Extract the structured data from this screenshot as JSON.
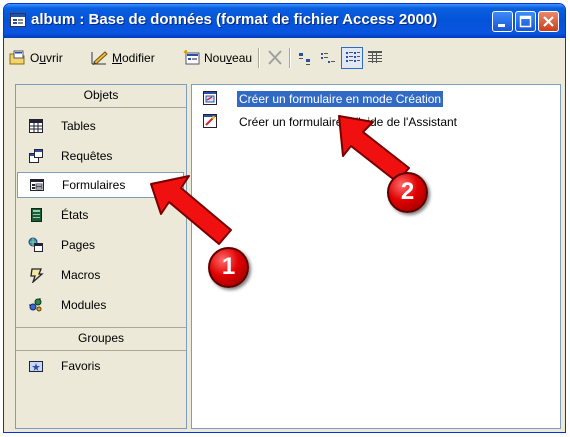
{
  "window": {
    "title": "album : Base de données (format de fichier Access 2000)"
  },
  "toolbar": {
    "open": {
      "pre": "O",
      "ul": "u",
      "post": "vrir",
      "icon": "open-form-icon"
    },
    "modify": {
      "ul": "M",
      "post": "odifier",
      "icon": "design-view-icon"
    },
    "new": {
      "pre": "Nou",
      "ul": "v",
      "post": "eau",
      "icon": "new-object-icon"
    },
    "delete_icon": "delete-x-icon",
    "views": [
      "large-icons-view-icon",
      "small-icons-view-icon",
      "list-view-icon",
      "details-view-icon"
    ],
    "active_view": "list-view-icon"
  },
  "objects_pane": {
    "header": "Objets",
    "items": [
      {
        "label": "Tables",
        "icon": "table-icon"
      },
      {
        "label": "Requêtes",
        "icon": "query-icon"
      },
      {
        "label": "Formulaires",
        "icon": "form-icon",
        "selected": true
      },
      {
        "label": "États",
        "icon": "report-icon"
      },
      {
        "label": "Pages",
        "icon": "page-icon"
      },
      {
        "label": "Macros",
        "icon": "macro-icon"
      },
      {
        "label": "Modules",
        "icon": "module-icon"
      }
    ],
    "groups_header": "Groupes",
    "groups": [
      {
        "label": "Favoris",
        "icon": "favorites-icon"
      }
    ]
  },
  "list": {
    "items": [
      {
        "label": "Créer un formulaire en mode Création",
        "icon": "design-form-icon",
        "selected": true
      },
      {
        "label": "Créer un formulaire à l'aide de l'Assistant",
        "icon": "wizard-form-icon",
        "selected": false
      }
    ]
  },
  "callouts": [
    {
      "number": "1",
      "color": "#e00000"
    },
    {
      "number": "2",
      "color": "#e00000"
    }
  ],
  "colors": {
    "titlebar": "#0453d8",
    "selection": "#316ac5",
    "window_bg": "#ece9d8",
    "callout": "#e00000"
  }
}
